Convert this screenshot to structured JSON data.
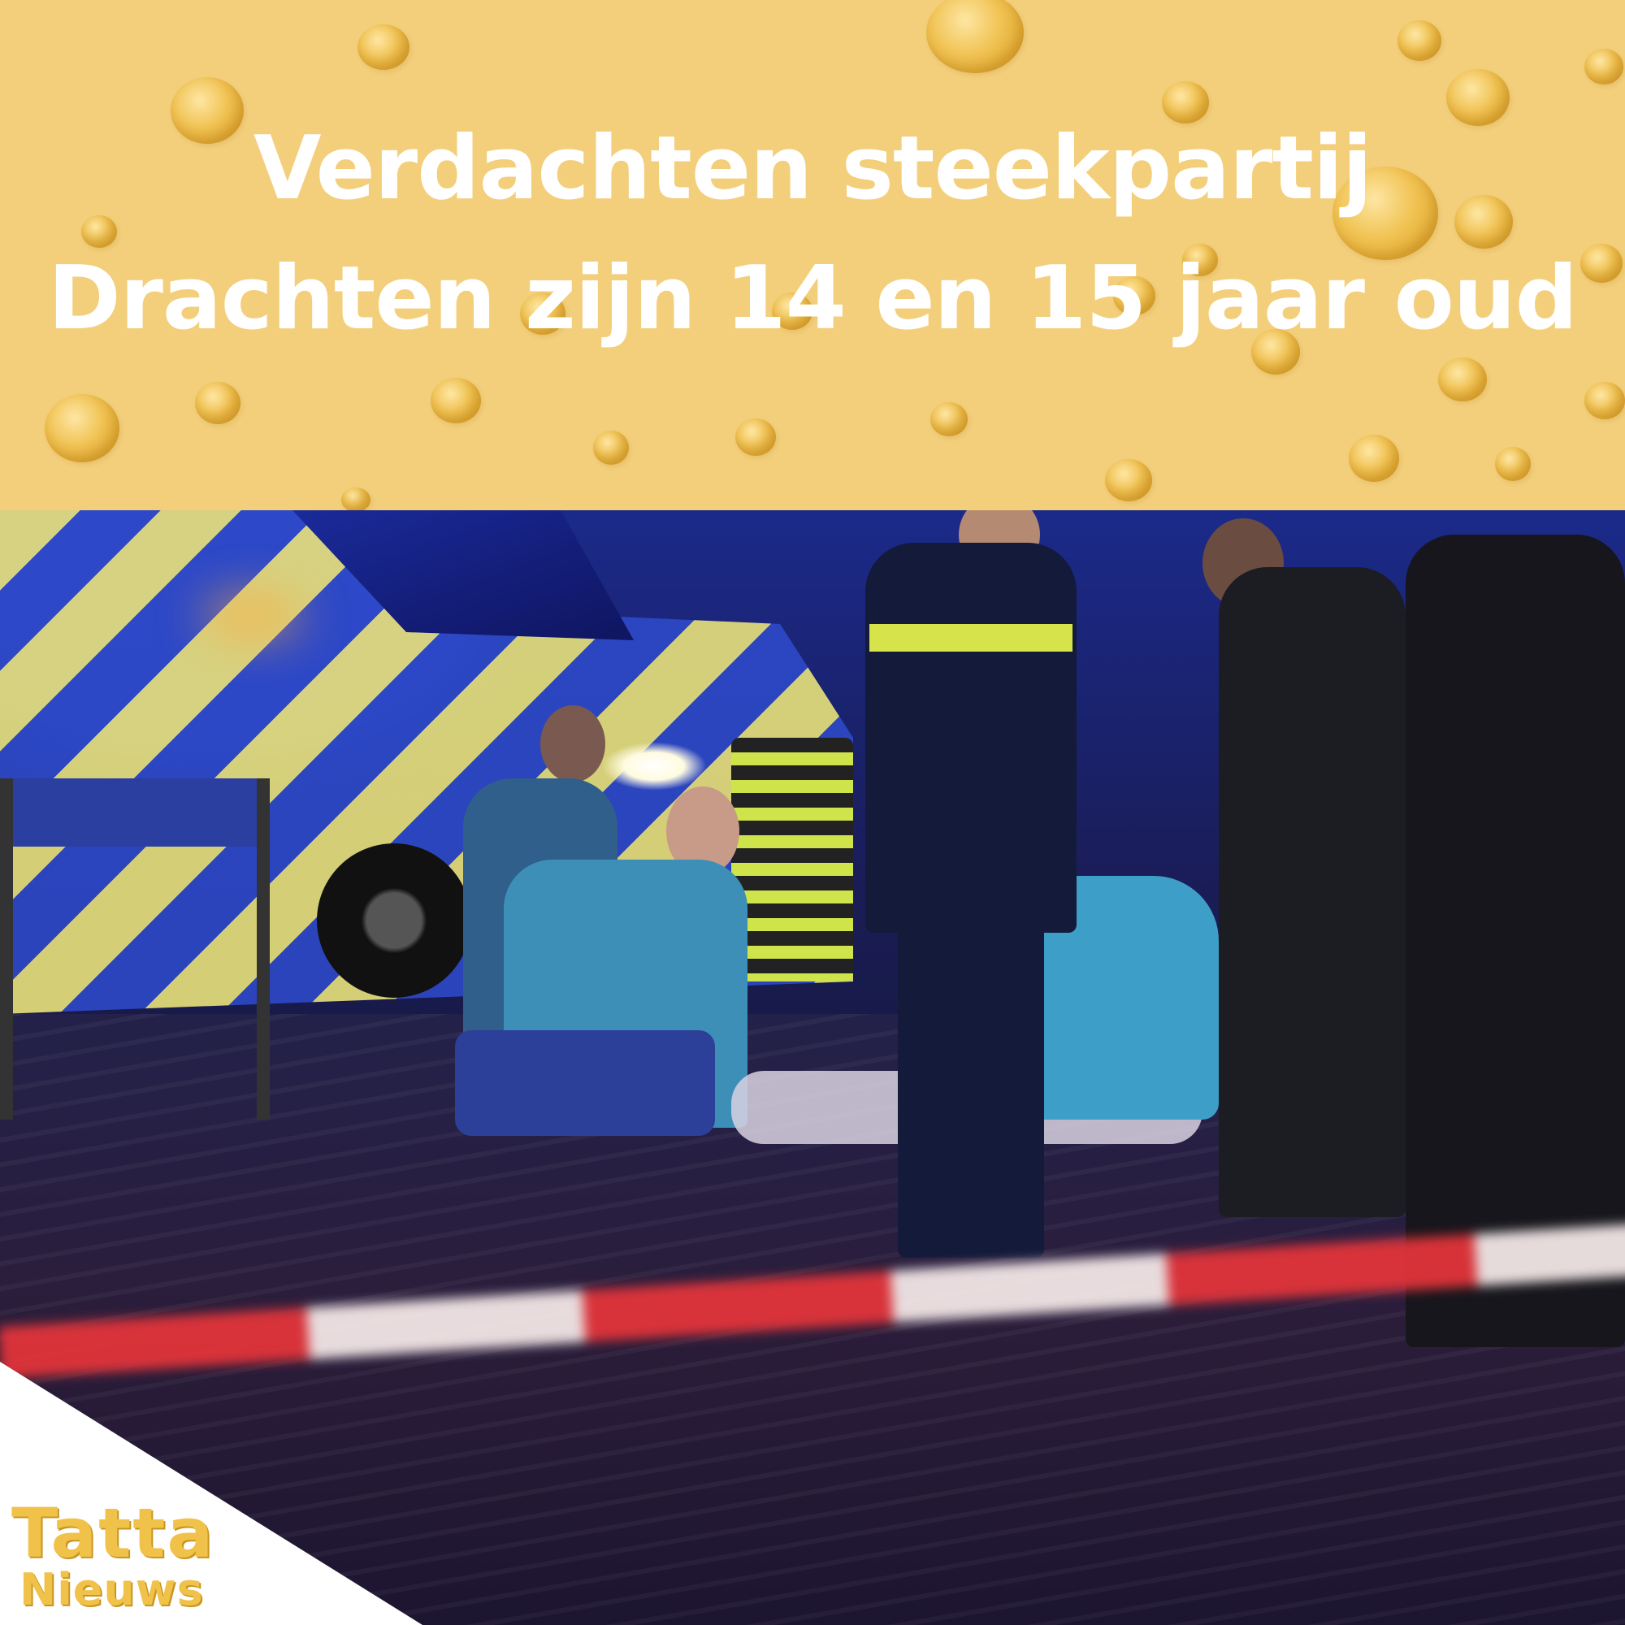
{
  "headline": {
    "line1": "Verdachten steekpartij",
    "line2": "Drachten zijn 14 en 15 jaar oud"
  },
  "logo": {
    "line1": "Tatta",
    "line2": "Nieuws"
  },
  "colors": {
    "banner_background": "#f3cf7c",
    "headline_text": "#ffffff",
    "logo_text": "#f0c24a"
  }
}
